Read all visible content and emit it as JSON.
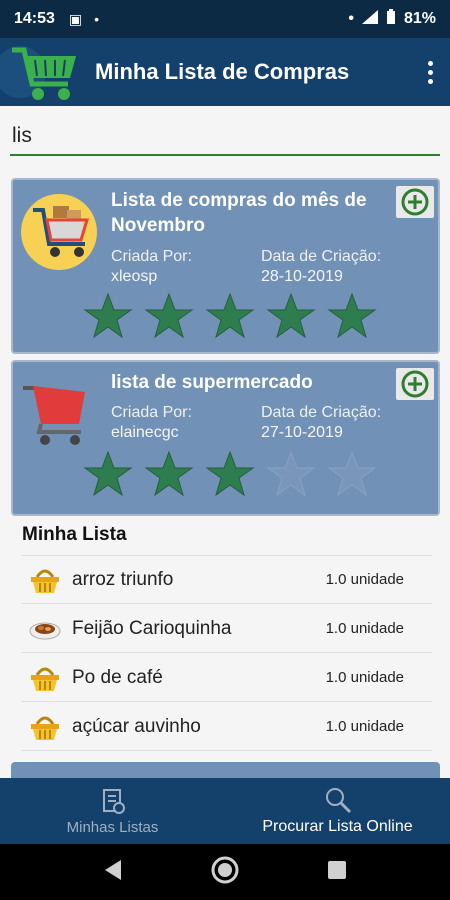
{
  "status_bar": {
    "time": "14:53",
    "battery": "81%"
  },
  "app_bar": {
    "title": "Minha Lista de Compras"
  },
  "search": {
    "value": "lis"
  },
  "online_lists": [
    {
      "title": "Lista de compras do mês de Novembro",
      "created_by_label": "Criada Por:",
      "created_by": "xleosp",
      "date_label": "Data de Criação:",
      "date": "28-10-2019",
      "rating": 5
    },
    {
      "title": "lista de supermercado",
      "created_by_label": "Criada Por:",
      "created_by": "elainecgc",
      "date_label": "Data de Criação:",
      "date": "27-10-2019",
      "rating": 3
    }
  ],
  "my_list": {
    "title": "Minha Lista",
    "items": [
      {
        "name": "arroz triunfo",
        "qty": "1.0 unidade",
        "icon": "basket-icon"
      },
      {
        "name": "Feijão Carioquinha",
        "qty": "1.0 unidade",
        "icon": "beans-plate-icon"
      },
      {
        "name": "Po de café",
        "qty": "1.0 unidade",
        "icon": "basket-icon"
      },
      {
        "name": "açúcar auvinho",
        "qty": "1.0 unidade",
        "icon": "basket-icon"
      }
    ]
  },
  "bottom_nav": {
    "items": [
      {
        "label": "Minhas Listas",
        "icon": "list-document-icon",
        "active": false
      },
      {
        "label": "Procurar Lista Online",
        "icon": "search-icon",
        "active": true
      }
    ]
  },
  "colors": {
    "primary": "#14416b",
    "card": "#7191b6",
    "star": "#2e7d4f",
    "accent_green": "#2e7d32"
  }
}
